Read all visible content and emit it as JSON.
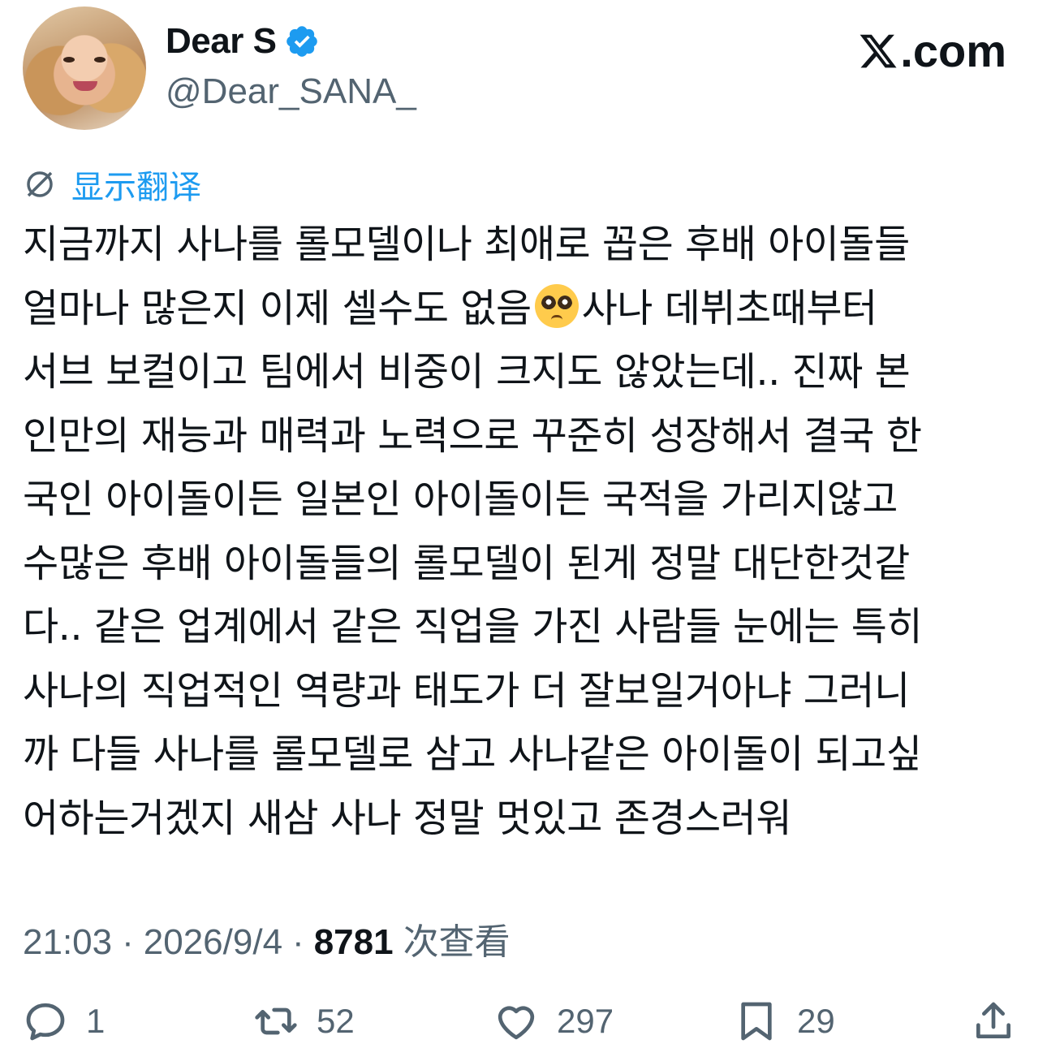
{
  "author": {
    "display_name": "Dear S",
    "handle": "@Dear_SANA_",
    "verified": true
  },
  "brand": {
    "label": ".com",
    "accent": "#0f1419"
  },
  "translate": {
    "label": "显示翻译",
    "color": "#1d9bf0"
  },
  "tweet": {
    "lines": [
      "지금까지 사나를 롤모델이나 최애로 꼽은 후배 아이돌들",
      "얼마나 많은지 이제 셀수도 없음",
      "사나 데뷔초때부터",
      "서브 보컬이고 팀에서 비중이 크지도 않았는데.. 진짜 본",
      "인만의 재능과 매력과 노력으로 꾸준히 성장해서 결국 한",
      "국인 아이돌이든 일본인 아이돌이든 국적을 가리지않고",
      "수많은 후배 아이돌들의 롤모델이 된게 정말 대단한것같",
      "다.. 같은 업계에서 같은 직업을 가진 사람들 눈에는 특히",
      "사나의 직업적인 역량과 태도가 더 잘보일거아냐 그러니",
      "까 다들 사나를 롤모델로 삼고 사나같은 아이돌이 되고싶",
      "어하는거겠지 새삼 사나 정말 멋있고 존경스러워"
    ],
    "emoji": "pleading-face"
  },
  "meta": {
    "time": "21:03",
    "sep1": "·",
    "date": "2026/9/4",
    "sep2": "·",
    "views": "8781",
    "views_label": "次查看"
  },
  "actions": {
    "replies": "1",
    "reposts": "52",
    "likes": "297",
    "bookmarks": "29"
  },
  "colors": {
    "text": "#0f1419",
    "secondary": "#536471",
    "verified": "#1d9bf0"
  }
}
